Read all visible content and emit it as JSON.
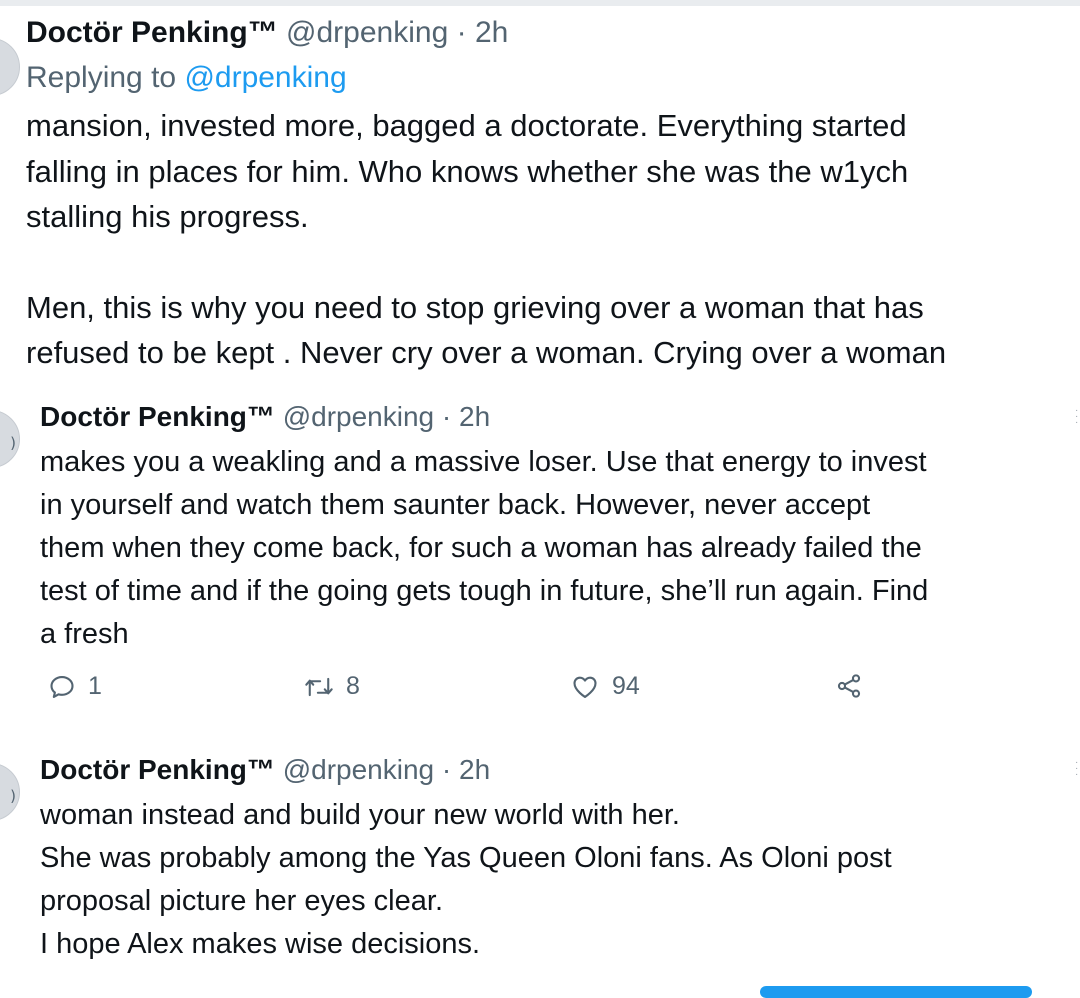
{
  "tweets": [
    {
      "name": "Doctör Penking™",
      "handle": "@drpenking",
      "time": "2h",
      "replying_prefix": "Replying to ",
      "replying_mention": "@drpenking",
      "lines": [
        "mansion, invested more, bagged a doctorate. Everything started",
        "falling in places for him. Who knows whether she was the w1ych",
        "stalling his progress.",
        "Men, this is why you need to stop grieving over a woman that has",
        "refused to be kept . Never cry over a woman. Crying over a woman"
      ]
    },
    {
      "name": "Doctör Penking™",
      "handle": "@drpenking",
      "time": "2h",
      "lines": [
        "makes you a weakling and a massive loser. Use that energy to invest",
        "in yourself and watch them saunter back. However, never accept",
        "them when they come back, for such a woman has already failed the",
        "test of time and if the going gets tough in future, she’ll run again. Find",
        "a fresh"
      ],
      "actions": {
        "reply_count": "1",
        "retweet_count": "8",
        "like_count": "94",
        "reply_icon": "reply-icon",
        "retweet_icon": "retweet-icon",
        "like_icon": "heart-icon",
        "share_icon": "share-icon"
      }
    },
    {
      "name": "Doctör Penking™",
      "handle": "@drpenking",
      "time": "2h",
      "lines": [
        "woman instead and build your new world with her.",
        "She was probably among the Yas Queen Oloni fans. As Oloni post",
        "proposal picture her eyes clear.",
        "I hope Alex makes wise decisions."
      ]
    }
  ],
  "separator": " · ",
  "colors": {
    "text": "#0f1419",
    "secondary": "#536471",
    "accent": "#1d9bf0"
  }
}
